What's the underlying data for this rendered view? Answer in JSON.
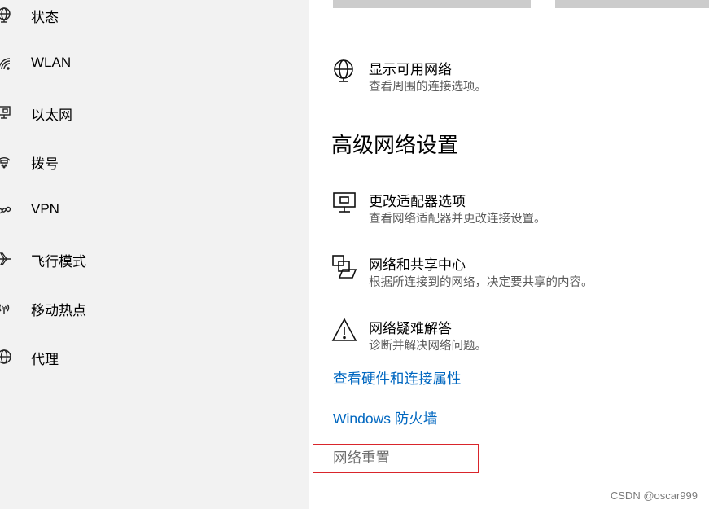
{
  "sidebar": {
    "items": [
      {
        "label": "状态",
        "icon": "status-globe-icon"
      },
      {
        "label": "WLAN",
        "icon": "wifi-icon"
      },
      {
        "label": "以太网",
        "icon": "ethernet-icon"
      },
      {
        "label": "拨号",
        "icon": "dialup-icon"
      },
      {
        "label": "VPN",
        "icon": "vpn-icon"
      },
      {
        "label": "飞行模式",
        "icon": "airplane-icon"
      },
      {
        "label": "移动热点",
        "icon": "hotspot-icon"
      },
      {
        "label": "代理",
        "icon": "proxy-globe-icon"
      }
    ]
  },
  "main": {
    "show_networks": {
      "title": "显示可用网络",
      "desc": "查看周围的连接选项。",
      "icon": "globe-icon"
    },
    "section_title": "高级网络设置",
    "options": [
      {
        "title": "更改适配器选项",
        "desc": "查看网络适配器并更改连接设置。",
        "icon": "adapter-icon"
      },
      {
        "title": "网络和共享中心",
        "desc": "根据所连接到的网络，决定要共享的内容。",
        "icon": "sharing-center-icon"
      },
      {
        "title": "网络疑难解答",
        "desc": "诊断并解决网络问题。",
        "icon": "warning-icon"
      }
    ],
    "links": {
      "hardware": "查看硬件和连接属性",
      "firewall": "Windows 防火墙",
      "reset": "网络重置"
    }
  },
  "watermark": "CSDN @oscar999",
  "colors": {
    "link": "#0067c0",
    "sidebar_bg": "#f2f2f2",
    "highlight_box": "#d9252b"
  }
}
